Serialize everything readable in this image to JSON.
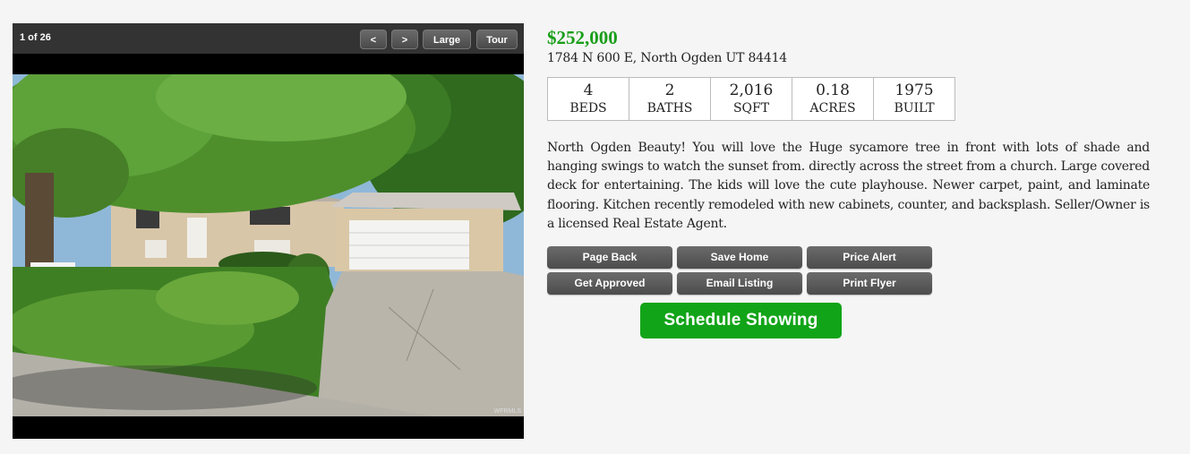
{
  "gallery": {
    "counter": "1 of 26",
    "prev_label": "<",
    "next_label": ">",
    "large_label": "Large",
    "tour_label": "Tour",
    "watermark": "WFRMLS"
  },
  "listing": {
    "price": "$252,000",
    "address": "1784 N 600 E, North Ogden UT 84414",
    "stats": [
      {
        "value": "4",
        "label": "BEDS"
      },
      {
        "value": "2",
        "label": "BATHS"
      },
      {
        "value": "2,016",
        "label": "SQFT"
      },
      {
        "value": "0.18",
        "label": "ACRES"
      },
      {
        "value": "1975",
        "label": "BUILT"
      }
    ],
    "description": "North Ogden Beauty! You will love the Huge sycamore tree in front with lots of shade and hanging swings to watch the sunset from. directly across the street from a church. Large covered deck for entertaining. The kids will love the cute playhouse. Newer carpet, paint, and laminate flooring. Kitchen recently remodeled with new cabinets, counter, and backsplash. Seller/Owner is a licensed Real Estate Agent."
  },
  "actions": {
    "page_back": "Page Back",
    "save_home": "Save Home",
    "price_alert": "Price Alert",
    "get_approved": "Get Approved",
    "email_listing": "Email Listing",
    "print_flyer": "Print Flyer",
    "schedule_showing": "Schedule Showing"
  },
  "colors": {
    "price": "#1a9e1a",
    "schedule_button": "#12a418",
    "action_button": "#5a5a5a",
    "gallery_bar": "#333333"
  }
}
